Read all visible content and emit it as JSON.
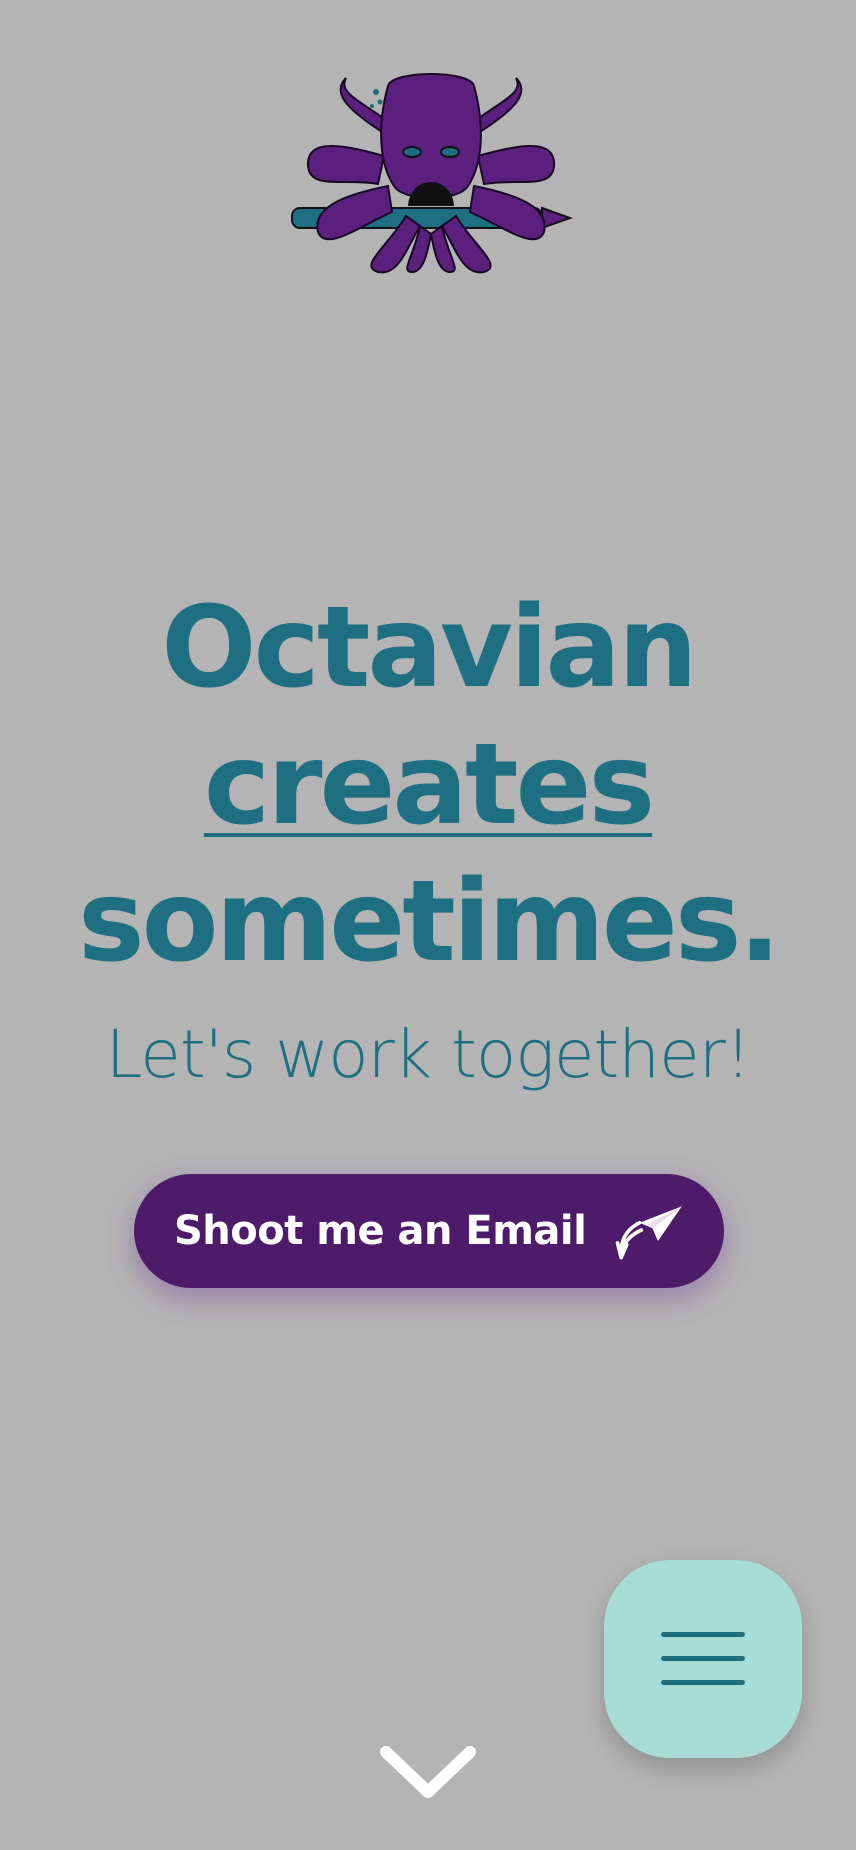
{
  "colors": {
    "background": "#b4b4b4",
    "headline": "#1e6f82",
    "button_bg": "#4e1b6a",
    "menu_bg": "#a7ddd6",
    "octopus": "#5b1f7e",
    "pencil": "#1e6f82"
  },
  "logo": {
    "icon": "octopus-pencil-logo"
  },
  "hero": {
    "line1": "Octavian",
    "line2": "creates",
    "line3": "sometimes.",
    "subtitle": "Let's work together!"
  },
  "cta": {
    "label": "Shoot me an Email",
    "icon": "paper-plane-icon"
  },
  "menu": {
    "icon": "hamburger-menu-icon"
  },
  "scroll": {
    "icon": "chevron-down-icon"
  }
}
